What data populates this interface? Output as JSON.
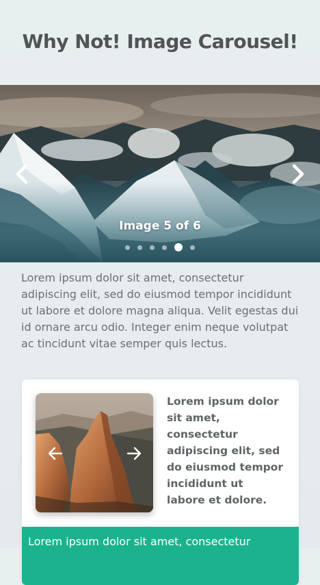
{
  "page": {
    "title": "Why Not! Image Carousel!"
  },
  "hero_carousel": {
    "caption": "Image 5 of 6",
    "slide_count": 6,
    "active_index": 5,
    "prev_icon": "chevron-left-icon",
    "next_icon": "chevron-right-icon"
  },
  "intro": {
    "text": "Lorem ipsum dolor sit amet, consectetur adipiscing elit, sed do eiusmod tempor incididunt ut labore et dolore magna aliqua. Velit egestas dui id ornare arcu odio. Integer enim neque volutpat ac tincidunt vitae semper quis lectus."
  },
  "card": {
    "text": "Lorem ipsum dolor sit amet, consectetur adipiscing elit, sed do eiusmod tempor incididunt ut labore et dolore.",
    "footer_text": "Lorem ipsum dolor sit amet, consectetur",
    "mini_carousel": {
      "prev_icon": "arrow-left-icon",
      "next_icon": "arrow-right-icon"
    }
  },
  "colors": {
    "background": "#e8efef",
    "accent": "#1bb38e",
    "title": "#505456",
    "body_text": "#6b7073"
  }
}
